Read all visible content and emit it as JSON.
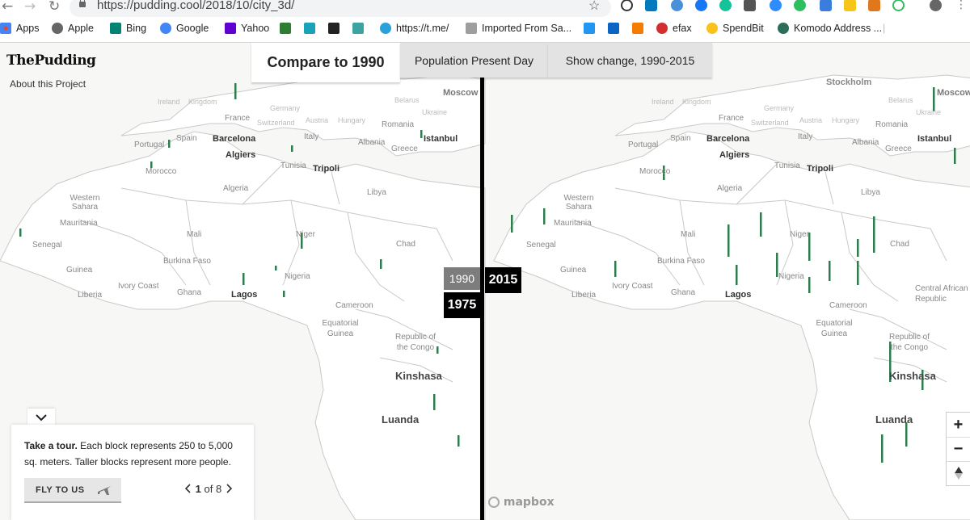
{
  "browser": {
    "url": "https://pudding.cool/2018/10/city_3d/",
    "back_icon": "arrow-left-icon",
    "forward_icon": "arrow-right-icon",
    "reload_icon": "reload-icon",
    "star_icon": "star-icon",
    "bookmarks": [
      {
        "label": "Apps",
        "icon": "apps-grid-icon"
      },
      {
        "label": "Apple",
        "icon": "apple-icon"
      },
      {
        "label": "Bing",
        "icon": "bing-icon"
      },
      {
        "label": "Google",
        "icon": "google-icon"
      },
      {
        "label": "Yahoo",
        "icon": "yahoo-icon"
      },
      {
        "label": "https://t.me/",
        "icon": "telegram-icon"
      },
      {
        "label": "Imported From Sa...",
        "icon": "folder-icon"
      },
      {
        "label": "efax",
        "icon": "efax-icon"
      },
      {
        "label": "SpendBit",
        "icon": "spendbit-icon"
      },
      {
        "label": "Komodo Address ...",
        "icon": "komodo-icon"
      }
    ]
  },
  "header": {
    "logo": "ThePudding",
    "about": "About this Project"
  },
  "tabs": [
    {
      "label": "Compare to 1990",
      "active": true
    },
    {
      "label": "Population Present Day",
      "active": false
    },
    {
      "label": "Show change, 1990-2015",
      "active": false
    }
  ],
  "years": {
    "left_selected": "1990",
    "left_option": "1975",
    "right": "2015"
  },
  "map_labels": {
    "countries": [
      "Ireland",
      "Kingdom",
      "France",
      "Germany",
      "Switzerland",
      "Austria",
      "Hungary",
      "Romania",
      "Ukraine",
      "Belarus",
      "Portugal",
      "Spain",
      "Italy",
      "Albania",
      "Greece",
      "Morocco",
      "Tunisia",
      "Algeria",
      "Libya",
      "Western Sahara",
      "Mauritania",
      "Mali",
      "Niger",
      "Chad",
      "Senegal",
      "Guinea",
      "Burkina Faso",
      "Ivory Coast",
      "Ghana",
      "Liberia",
      "Nigeria",
      "Cameroon",
      "Equatorial Guinea",
      "Republic of the Congo",
      "Central African Republic"
    ],
    "cities": [
      "Barcelona",
      "Algiers",
      "Tripoli",
      "Istanbul",
      "Lagos",
      "Moscow",
      "Stockholm"
    ],
    "big_cities": [
      "Kinshasa",
      "Luanda"
    ]
  },
  "tour": {
    "toggle_icon": "chevron-down-icon",
    "title": "Take a tour.",
    "text": "Each block represents 250 to 5,000 sq. meters. Taller blocks represent more people.",
    "button": "FLY TO US",
    "button_icon": "airplane-icon",
    "current": "1",
    "of": "of 8",
    "prev_icon": "chevron-left-icon",
    "next_icon": "chevron-right-icon"
  },
  "zoom": {
    "in": "+",
    "out": "−",
    "compass_icon": "compass-icon"
  },
  "attribution": "mapbox",
  "colors": {
    "spike": "#2f7d4e",
    "land": "#ffffff",
    "water": "#f4f4f2",
    "border": "#c9c9c9"
  }
}
